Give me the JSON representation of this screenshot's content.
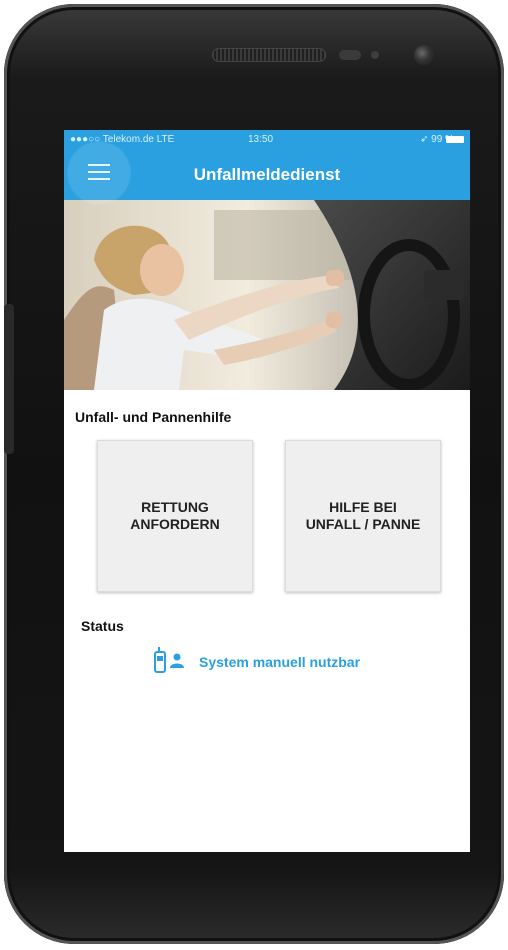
{
  "statusbar": {
    "carrier": "●●●○○ Telekom.de  LTE",
    "time": "13:50",
    "battery": "➶ 99 %"
  },
  "appbar": {
    "title": "Unfallmeldedienst",
    "menu_icon": "hamburger-menu-icon"
  },
  "hero": {
    "image": "woman-driving-car-photo"
  },
  "assistance": {
    "title": "Unfall- und Pannenhilfe",
    "buttons": [
      {
        "label": "RETTUNG\nANFORDERN"
      },
      {
        "label": "HILFE BEI\nUNFALL / PANNE"
      }
    ]
  },
  "status": {
    "title": "Status",
    "icon": "phone-person-icon",
    "text": "System manuell nutzbar"
  },
  "colors": {
    "accent": "#2aa0e0",
    "button_bg": "#efefef",
    "phone_body": "#111111"
  }
}
